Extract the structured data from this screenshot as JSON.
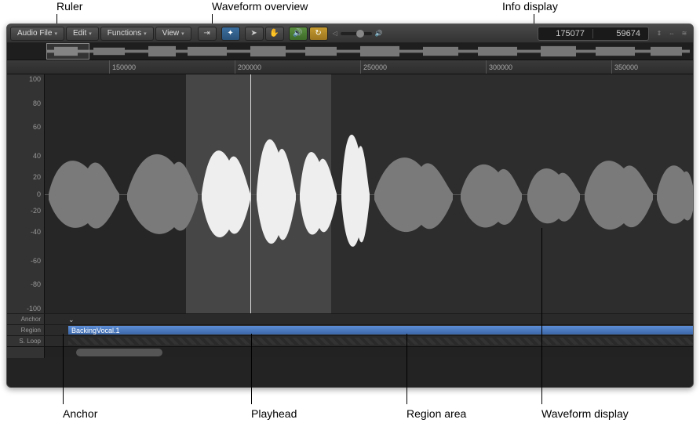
{
  "callouts_top": {
    "ruler": "Ruler",
    "overview": "Waveform overview",
    "info": "Info display"
  },
  "callouts_bottom": {
    "anchor": "Anchor",
    "playhead": "Playhead",
    "region": "Region area",
    "wavedisplay": "Waveform display"
  },
  "toolbar": {
    "menus": [
      "Audio File",
      "Edit",
      "Functions",
      "View"
    ],
    "icons": {
      "catch": "catch-mode-icon",
      "filter": "flex-icon",
      "pointer": "pointer-tool-icon",
      "hand": "hand-tool-icon",
      "speaker": "preview-icon",
      "cycle": "cycle-icon"
    }
  },
  "volume_slider": "",
  "info_display": {
    "position": "175077",
    "length": "59674"
  },
  "ruler_ticks": [
    "150000",
    "200000",
    "250000",
    "300000",
    "350000"
  ],
  "amplitude_ticks": [
    "100",
    "80",
    "60",
    "40",
    "20",
    "0",
    "-20",
    "-40",
    "-60",
    "-80",
    "-100"
  ],
  "lanes": {
    "anchor": "Anchor",
    "region": "Region",
    "sloop": "S. Loop"
  },
  "region_name": "BackingVocal.1"
}
